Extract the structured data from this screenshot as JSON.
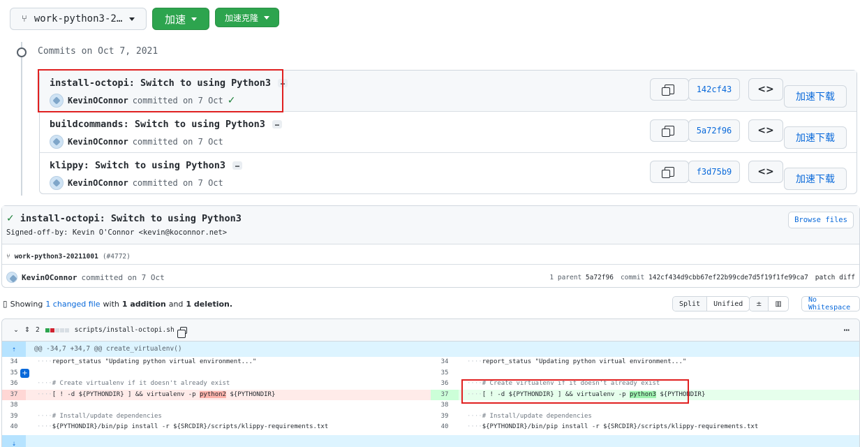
{
  "topbar": {
    "branch": "work-python3-2…",
    "speed_btn": "加速",
    "clone_btn": "加速克隆"
  },
  "timeline": {
    "date_label": "Commits on Oct 7, 2021"
  },
  "commits": [
    {
      "title": "install-octopi: Switch to using Python3",
      "author": "KevinOConnor",
      "meta": "committed on 7 Oct",
      "sha": "142cf43",
      "download": "加速下载",
      "verified": true
    },
    {
      "title": "buildcommands: Switch to using Python3",
      "author": "KevinOConnor",
      "meta": "committed on 7 Oct",
      "sha": "5a72f96",
      "download": "加速下载",
      "verified": false
    },
    {
      "title": "klippy: Switch to using Python3",
      "author": "KevinOConnor",
      "meta": "committed on 7 Oct",
      "sha": "f3d75b9",
      "download": "加速下载",
      "verified": false
    }
  ],
  "detail": {
    "title": "install-octopi: Switch to using Python3",
    "signed_off": "Signed-off-by: Kevin O'Connor <kevin@koconnor.net>",
    "browse_files": "Browse files",
    "branch": "work-python3-20211001",
    "pr": "(#4772)",
    "author": "KevinOConnor",
    "committed": "committed on 7 Oct",
    "parent_label": "1 parent",
    "parent_sha": "5a72f96",
    "commit_label": "commit",
    "commit_sha": "142cf434d9cbb67ef22b99cde7d5f19f1fe99ca7",
    "patch_diff": "patch diff"
  },
  "summary": {
    "showing": "Showing",
    "changed": "1 changed file",
    "with": "with",
    "additions": "1 addition",
    "and": "and",
    "deletions": "1 deletion."
  },
  "view": {
    "split": "Split",
    "unified": "Unified",
    "no_whitespace": "No Whitespace"
  },
  "file": {
    "count": "2",
    "path": "scripts/install-octopi.sh",
    "hunk": "@@ -34,7 +34,7 @@ create_virtualenv()"
  },
  "diff": {
    "left_nums": [
      "34",
      "35",
      "36",
      "37",
      "38",
      "39",
      "40"
    ],
    "right_nums": [
      "34",
      "35",
      "36",
      "37",
      "38",
      "39",
      "40"
    ],
    "line34": "report_status \"Updating python virtual environment...\"",
    "line36": "# Create virtualenv if it doesn't already exist",
    "line37_pre": "[ ! -d ${PYTHONDIR} ] && virtualenv -p ",
    "line37_old": "python2",
    "line37_new": "python3",
    "line37_post": " ${PYTHONDIR}",
    "line39": "# Install/update dependencies",
    "line40": "${PYTHONDIR}/bin/pip install -r ${SRCDIR}/scripts/klippy-requirements.txt"
  },
  "colors": {
    "accent": "#2da44e",
    "link": "#0969da",
    "highlight_box": "#e02020"
  }
}
